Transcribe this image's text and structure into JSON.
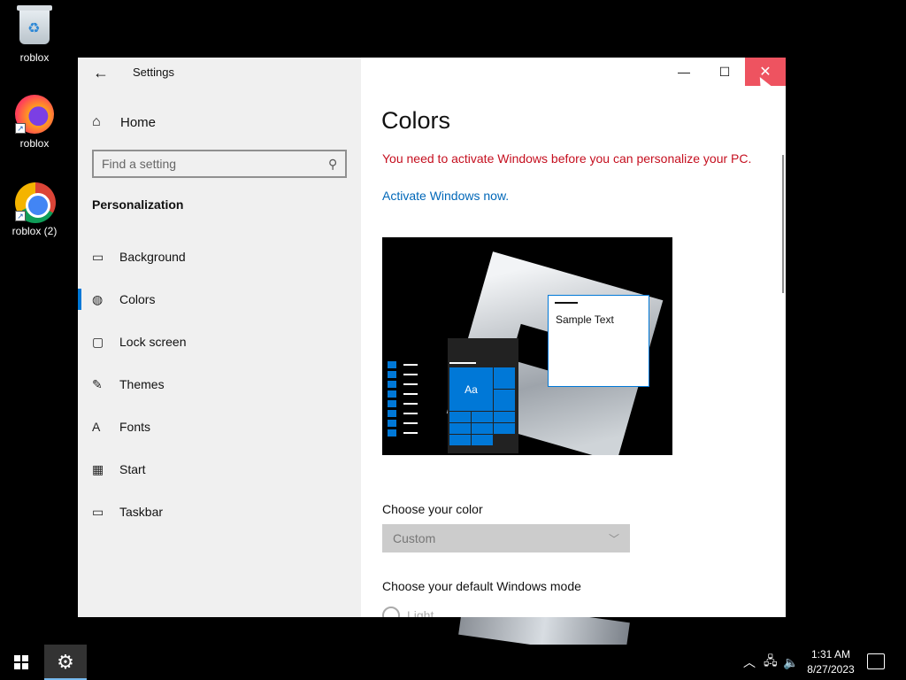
{
  "desktop": {
    "icons": [
      {
        "label": "roblox",
        "icon": "recycle-bin-icon"
      },
      {
        "label": "roblox",
        "icon": "firefox-icon"
      },
      {
        "label": "roblox (2)",
        "icon": "chrome-icon"
      }
    ]
  },
  "window": {
    "app_title": "Settings",
    "home_label": "Home",
    "search_placeholder": "Find a setting",
    "section_heading": "Personalization",
    "nav_items": [
      {
        "label": "Background",
        "icon": "picture-icon"
      },
      {
        "label": "Colors",
        "icon": "palette-icon",
        "active": true
      },
      {
        "label": "Lock screen",
        "icon": "lock-screen-icon"
      },
      {
        "label": "Themes",
        "icon": "brush-icon"
      },
      {
        "label": "Fonts",
        "icon": "fonts-icon"
      },
      {
        "label": "Start",
        "icon": "start-icon"
      },
      {
        "label": "Taskbar",
        "icon": "taskbar-icon"
      }
    ],
    "controls": {
      "minimize": "—",
      "maximize": "☐",
      "close": "✕"
    }
  },
  "colors_page": {
    "title": "Colors",
    "activation_warning": "You need to activate Windows before you can personalize your PC.",
    "activate_link": "Activate Windows now.",
    "preview": {
      "sample_text": "Sample Text",
      "tile_text": "Aa"
    },
    "choose_color_label": "Choose your color",
    "choose_color_value": "Custom",
    "mode_label": "Choose your default Windows mode",
    "mode_option": "Light",
    "accent_color": "#0078d7",
    "warning_color": "#c50f1f"
  },
  "taskbar": {
    "time": "1:31 AM",
    "date": "8/27/2023"
  }
}
